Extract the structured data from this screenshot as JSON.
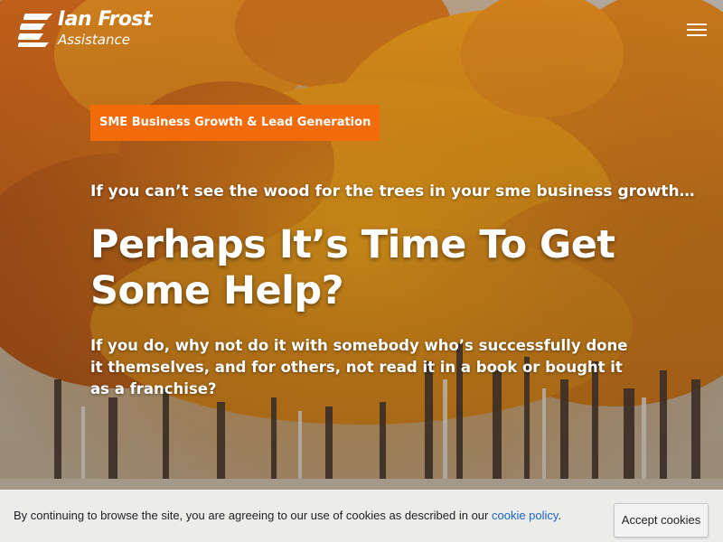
{
  "header": {
    "logo_name": "Ian Frost",
    "logo_sub": "Assistance",
    "menu_icon": "hamburger-menu-icon"
  },
  "hero": {
    "tag": "SME Business Growth & Lead Generation",
    "kicker": "If you can’t see the wood for the trees in your sme business growth…",
    "headline": "Perhaps It’s Time To Get Some Help?",
    "subtext": "If you do, why not do it with somebody who’s successfully done it themselves, and for others, not read it in a book or bought it as a franchise?"
  },
  "cookie_bar": {
    "text_before": "By continuing to browse the site, you are agreeing to our use of cookies as described in our ",
    "link_label": "cookie policy",
    "text_after": ".",
    "accept_label": "Accept cookies"
  },
  "colors": {
    "tag_background": "#f26b0a",
    "link": "#1a63c9",
    "cookie_bar_background": "#f0f0f0"
  }
}
